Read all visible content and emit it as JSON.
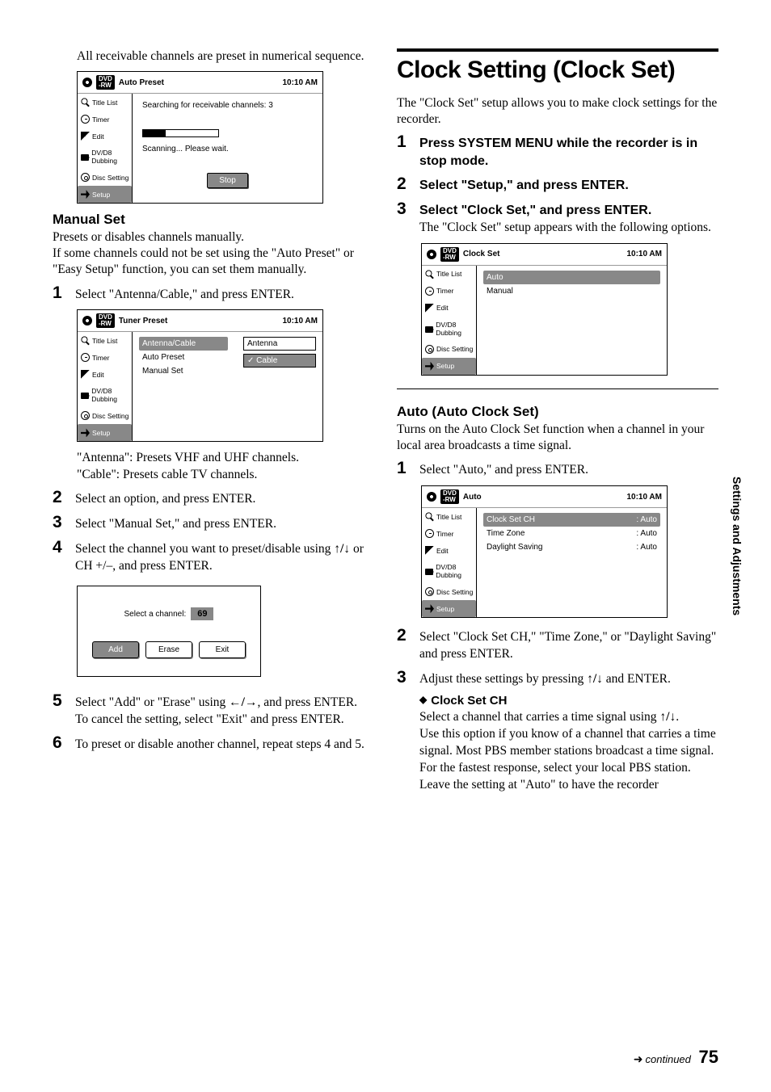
{
  "sideTab": "Settings and Adjustments",
  "footer": {
    "cont": "continued",
    "page": "75"
  },
  "left": {
    "intro": "All receivable channels are preset in numerical sequence.",
    "ui1": {
      "title": "Auto Preset",
      "time": "10:10 AM",
      "sidebar": [
        "Title List",
        "Timer",
        "Edit",
        "DV/D8 Dubbing",
        "Disc Setting",
        "Setup"
      ],
      "searching": "Searching for receivable channels:  3",
      "scanning": "Scanning... Please wait.",
      "stop": "Stop"
    },
    "manualSet": {
      "heading": "Manual Set",
      "p1": "Presets or disables channels manually.",
      "p2": "If some channels could not be set using the \"Auto Preset\" or \"Easy Setup\" function, you can set them manually.",
      "s1": "Select \"Antenna/Cable,\" and press ENTER.",
      "ui2": {
        "title": "Tuner Preset",
        "time": "10:10 AM",
        "rows": [
          "Antenna/Cable",
          "Auto Preset",
          "Manual Set"
        ],
        "optAntenna": "Antenna",
        "optCable": "Cable"
      },
      "noteAntenna": "\"Antenna\": Presets VHF and UHF channels.",
      "noteCable": "\"Cable\": Presets cable TV channels.",
      "s2": "Select an option, and press ENTER.",
      "s3": "Select \"Manual Set,\" and press ENTER.",
      "s4a": "Select the channel you want to preset/disable using ",
      "s4mid": " or CH +/–, and press ENTER.",
      "dlg": {
        "label": "Select a channel:",
        "num": "69",
        "add": "Add",
        "erase": "Erase",
        "exit": "Exit"
      },
      "s5a": "Select \"Add\" or \"Erase\" using ",
      "s5b": ", and press ENTER.",
      "s5c": "To cancel the setting, select \"Exit\" and press ENTER.",
      "s6": "To preset or disable another channel, repeat steps 4 and 5."
    }
  },
  "right": {
    "h1": "Clock Setting (Clock Set)",
    "p1": "The \"Clock Set\" setup allows you to make clock settings for the recorder.",
    "s1": "Press SYSTEM MENU while the recorder is in stop mode.",
    "s2": "Select \"Setup,\" and press ENTER.",
    "s3": "Select \"Clock Set,\" and press ENTER.",
    "s3b": "The \"Clock Set\" setup appears with the following options.",
    "ui3": {
      "title": "Clock Set",
      "time": "10:10 AM",
      "rows": [
        "Auto",
        "Manual"
      ]
    },
    "auto": {
      "heading": "Auto (Auto Clock Set)",
      "p": "Turns on the Auto Clock Set function when a channel in your local area broadcasts a time signal.",
      "s1": "Select \"Auto,\" and press ENTER.",
      "ui4": {
        "title": "Auto",
        "time": "10:10 AM",
        "r1a": "Clock Set CH",
        "r1b": ": Auto",
        "r2a": "Time Zone",
        "r2b": ": Auto",
        "r3a": "Daylight Saving",
        "r3b": ": Auto"
      },
      "s2": "Select \"Clock Set CH,\" \"Time Zone,\" or \"Daylight Saving\" and press ENTER.",
      "s3a": "Adjust these settings by pressing ",
      "s3b": " and ENTER.",
      "csHeading": "Clock Set CH",
      "cs1a": "Select a channel that carries a time signal using ",
      "cs1b": ".",
      "cs2": "Use this option if you know of a channel that carries a time signal. Most PBS member stations broadcast a time signal. For the fastest response, select your local PBS station. Leave the setting at \"Auto\" to have the recorder"
    }
  },
  "sym": {
    "updn": "↑/↓",
    "lr": "←/→"
  }
}
